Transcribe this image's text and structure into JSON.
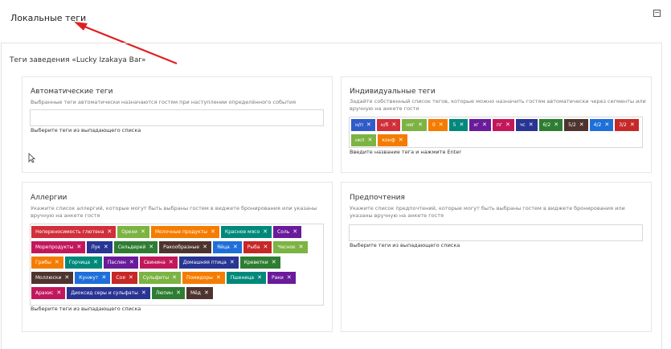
{
  "page_title": "Локальные теги",
  "collapse_symbol": "−",
  "venue_title": "Теги заведения «Lucky Izakaya Bar»",
  "remove_symbol": "✕",
  "auto": {
    "title": "Автоматические теги",
    "desc": "Выбранные теги автоматически назначаются гостям при наступлении определённого события",
    "hint": "Выберите теги из выпадающего списка"
  },
  "individual": {
    "title": "Индивидуальные теги",
    "desc": "Задайте собственный список тегов, которые можно назначить гостям автоматически через сегменты или вручную на анкете гостя",
    "hint": "Введите название тега и нажмите Enter",
    "tags": [
      {
        "label": "н/п",
        "color": "#2f5cc9"
      },
      {
        "label": "н/б",
        "color": "#d12f3a"
      },
      {
        "label": "нег",
        "color": "#7cb342"
      },
      {
        "label": "0",
        "color": "#f57c00"
      },
      {
        "label": "5",
        "color": "#00897b"
      },
      {
        "label": "хг",
        "color": "#6a1b9a"
      },
      {
        "label": "пг",
        "color": "#c2185b"
      },
      {
        "label": "чс",
        "color": "#283593"
      },
      {
        "label": "6/2",
        "color": "#2e7d32"
      },
      {
        "label": "5/2",
        "color": "#4e342e"
      },
      {
        "label": "4/2",
        "color": "#1e6fd9"
      },
      {
        "label": "3/2",
        "color": "#c62828"
      },
      {
        "label": "нкп",
        "color": "#7cb342"
      },
      {
        "label": "конф",
        "color": "#f57c00"
      }
    ]
  },
  "allergies": {
    "title": "Аллергии",
    "desc": "Укажите список аллергий, которые могут быть выбраны гостем в виджете бронирования или указаны вручную на анкете гостя",
    "hint": "Выберите теги из выпадающего списка",
    "tags": [
      {
        "label": "Непереносимость глютена",
        "color": "#d12f3a"
      },
      {
        "label": "Орехи",
        "color": "#7cb342"
      },
      {
        "label": "Молочные продукты",
        "color": "#f57c00"
      },
      {
        "label": "Красное мясо",
        "color": "#00897b"
      },
      {
        "label": "Соль",
        "color": "#6a1b9a"
      },
      {
        "label": "Морепродукты",
        "color": "#c2185b"
      },
      {
        "label": "Лук",
        "color": "#283593"
      },
      {
        "label": "Сельдерей",
        "color": "#2e7d32"
      },
      {
        "label": "Ракообразные",
        "color": "#4e342e"
      },
      {
        "label": "Яйца",
        "color": "#1e6fd9"
      },
      {
        "label": "Рыба",
        "color": "#c62828"
      },
      {
        "label": "Чеснок",
        "color": "#7cb342"
      },
      {
        "label": "Грибы",
        "color": "#f57c00"
      },
      {
        "label": "Горчица",
        "color": "#00897b"
      },
      {
        "label": "Паслен",
        "color": "#6a1b9a"
      },
      {
        "label": "Свинина",
        "color": "#c2185b"
      },
      {
        "label": "Домашняя птица",
        "color": "#283593"
      },
      {
        "label": "Креветки",
        "color": "#2e7d32"
      },
      {
        "label": "Моллюски",
        "color": "#4e342e"
      },
      {
        "label": "Кунжут",
        "color": "#1e6fd9"
      },
      {
        "label": "Соя",
        "color": "#c62828"
      },
      {
        "label": "Сульфиты",
        "color": "#7cb342"
      },
      {
        "label": "Помидоры",
        "color": "#f57c00"
      },
      {
        "label": "Пшеница",
        "color": "#00897b"
      },
      {
        "label": "Раки",
        "color": "#6a1b9a"
      },
      {
        "label": "Арахис",
        "color": "#c2185b"
      },
      {
        "label": "Диоксид серы и сульфаты",
        "color": "#283593"
      },
      {
        "label": "Люпин",
        "color": "#2e7d32"
      },
      {
        "label": "Мёд",
        "color": "#4e342e"
      }
    ]
  },
  "preferences": {
    "title": "Предпочтения",
    "desc": "Укажите список предпочтений, которые могут быть выбраны гостем в виджете бронирования или указаны вручную на анкете гостя",
    "hint": "Выберите теги из выпадающего списка"
  }
}
